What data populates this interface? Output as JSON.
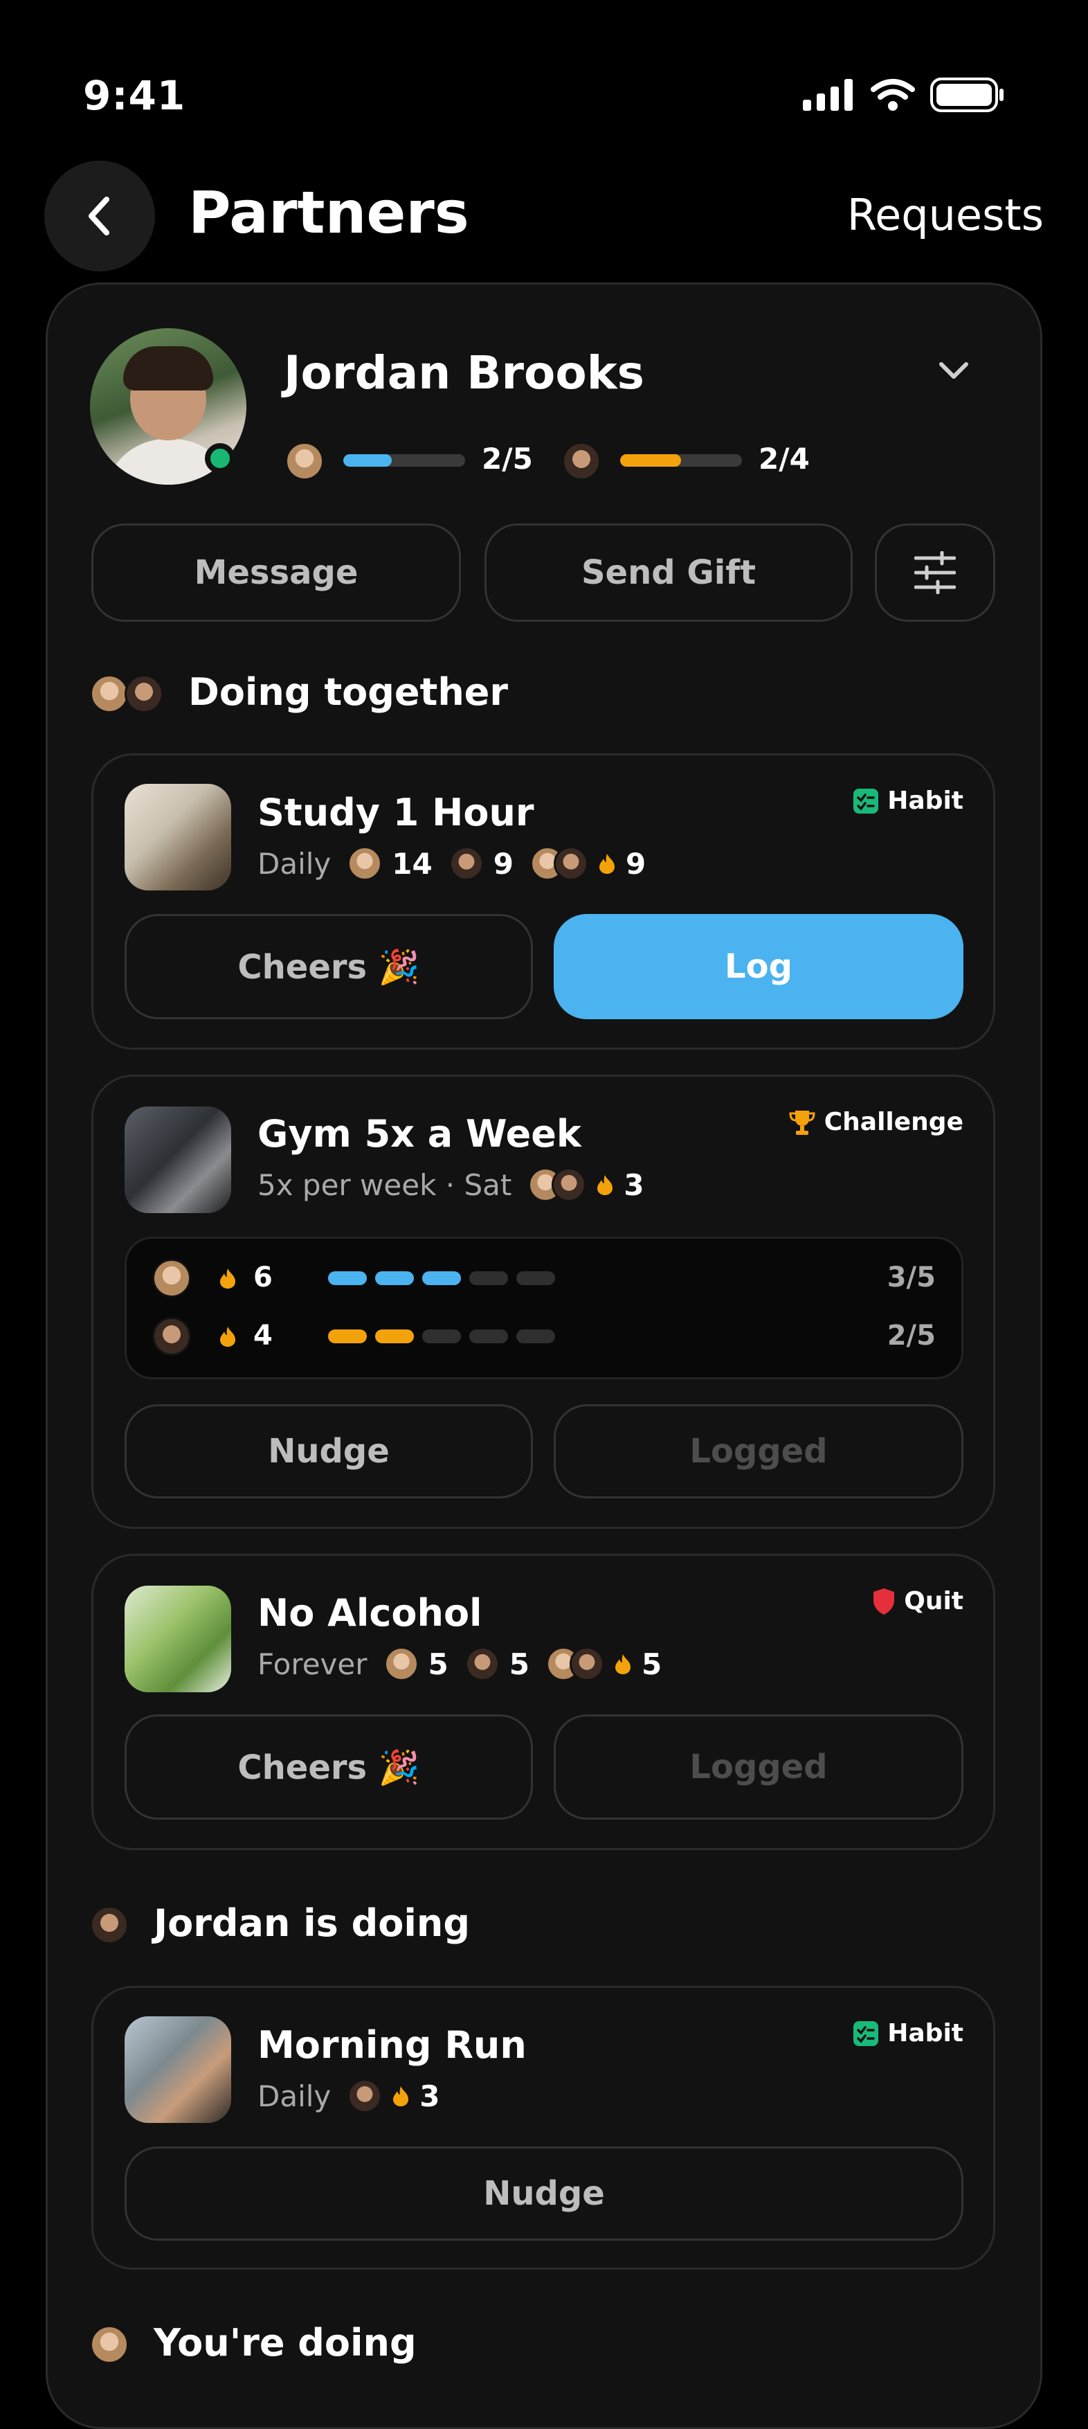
{
  "status": {
    "time": "9:41"
  },
  "header": {
    "title": "Partners",
    "requests_label": "Requests"
  },
  "partner": {
    "name": "Jordan Brooks",
    "progress": [
      {
        "label": "2/5",
        "fraction": 0.4,
        "color": "#4ab3f0"
      },
      {
        "label": "2/4",
        "fraction": 0.5,
        "color": "#f4a20c"
      }
    ]
  },
  "actions": {
    "message": "Message",
    "send_gift": "Send Gift"
  },
  "sections": {
    "together": "Doing together",
    "jordan": "Jordan is doing",
    "you": "You're doing"
  },
  "habits": [
    {
      "title": "Study 1 Hour",
      "frequency": "Daily",
      "tag": "Habit",
      "counts": [
        "14",
        "9",
        "9"
      ],
      "left_button": "Cheers 🎉",
      "right_button": "Log"
    },
    {
      "title": "Gym 5x a Week",
      "frequency": "5x per week · Sat",
      "tag": "Challenge",
      "counts": [
        "3"
      ],
      "rows": [
        {
          "streak": "6",
          "score": "3/5",
          "filled": 3,
          "color": "#4ab3f0"
        },
        {
          "streak": "4",
          "score": "2/5",
          "filled": 2,
          "color": "#f4a20c"
        }
      ],
      "left_button": "Nudge",
      "right_button": "Logged"
    },
    {
      "title": "No Alcohol",
      "frequency": "Forever",
      "tag": "Quit",
      "counts": [
        "5",
        "5",
        "5"
      ],
      "left_button": "Cheers 🎉",
      "right_button": "Logged"
    },
    {
      "title": "Morning Run",
      "frequency": "Daily",
      "tag": "Habit",
      "counts": [
        "3"
      ],
      "button": "Nudge"
    }
  ],
  "colors": {
    "accent": "#4ab3f0",
    "orange": "#f4a20c",
    "habit_green": "#19b97a",
    "quit_red": "#e5303c",
    "trophy": "#f4a20c"
  },
  "icons": [
    "chevron-left-icon",
    "chevron-down-icon",
    "sliders-icon",
    "flame-icon",
    "habit-icon",
    "trophy-icon",
    "shield-icon"
  ]
}
